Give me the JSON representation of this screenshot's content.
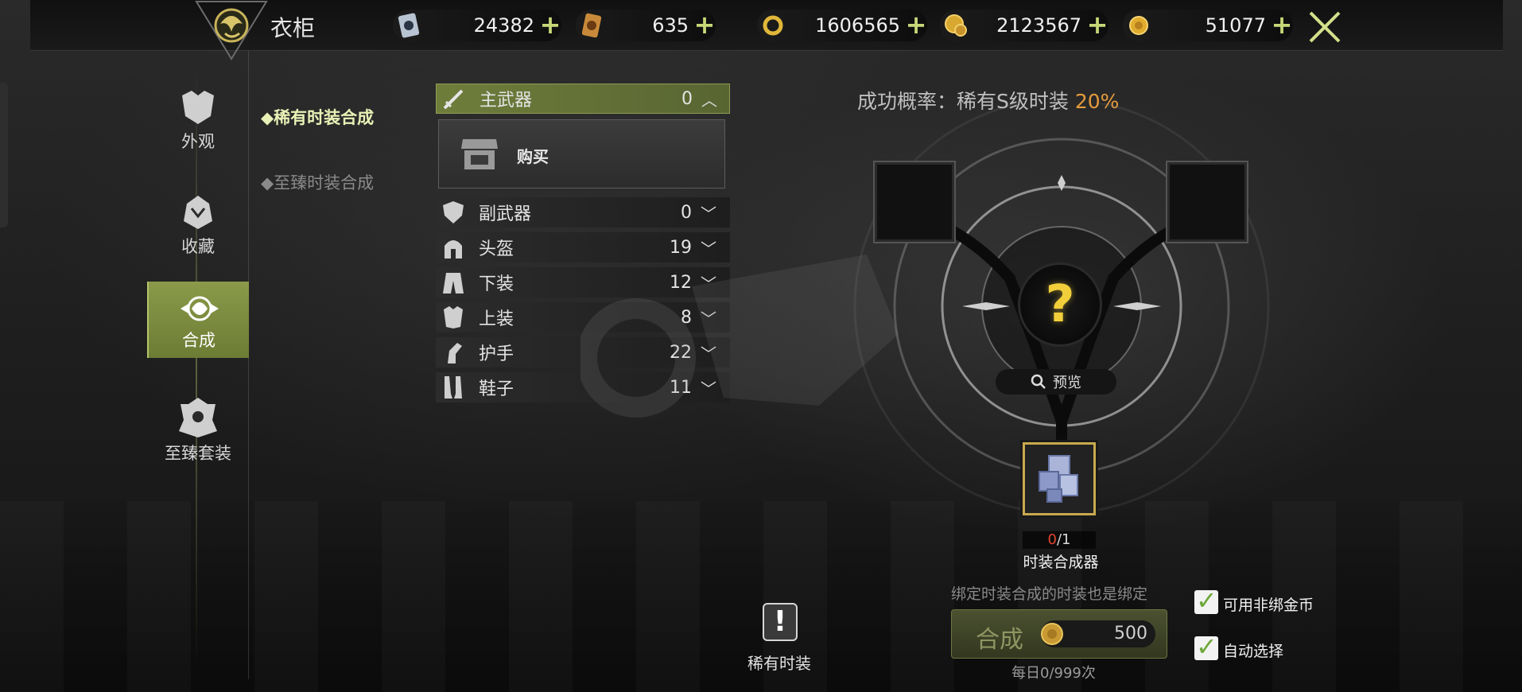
{
  "header": {
    "title": "衣柜",
    "currencies": [
      {
        "icon": "card-ticket-icon",
        "value": "24382"
      },
      {
        "icon": "gold-card-icon",
        "value": "635"
      },
      {
        "icon": "gold-ring-coin-icon",
        "value": "1606565"
      },
      {
        "icon": "gold-coin-stack-icon",
        "value": "2123567"
      },
      {
        "icon": "gold-coin-icon",
        "value": "51077"
      }
    ],
    "plus_symbol": "+"
  },
  "sidebar": {
    "items": [
      {
        "label": "外观",
        "icon": "armor-appearance-icon",
        "active": false
      },
      {
        "label": "收藏",
        "icon": "collection-icon",
        "active": false
      },
      {
        "label": "合成",
        "icon": "synthesis-icon",
        "active": true
      },
      {
        "label": "至臻套装",
        "icon": "supreme-set-icon",
        "active": false
      }
    ]
  },
  "submenu": {
    "items": [
      {
        "label": "稀有时装合成",
        "active": true
      },
      {
        "label": "至臻时装合成",
        "active": false
      }
    ]
  },
  "categories": [
    {
      "name": "主武器",
      "count": "0",
      "icon": "sword-icon",
      "expanded": true
    },
    {
      "name": "副武器",
      "count": "0",
      "icon": "shield-icon",
      "expanded": false
    },
    {
      "name": "头盔",
      "count": "19",
      "icon": "helmet-icon",
      "expanded": false
    },
    {
      "name": "下装",
      "count": "12",
      "icon": "pants-icon",
      "expanded": false
    },
    {
      "name": "上装",
      "count": "8",
      "icon": "chest-armor-icon",
      "expanded": false
    },
    {
      "name": "护手",
      "count": "22",
      "icon": "gauntlet-icon",
      "expanded": false
    },
    {
      "name": "鞋子",
      "count": "11",
      "icon": "boots-icon",
      "expanded": false
    }
  ],
  "buy": {
    "label": "购买",
    "icon": "shop-icon"
  },
  "synthesis": {
    "rate_label": "成功概率：稀有S级时装",
    "rate_value": "20%",
    "result_symbol": "?",
    "preview_label": "预览",
    "material": {
      "have": "0",
      "need": "/1",
      "name": "时装合成器"
    },
    "bind_note": "绑定时装合成的时装也是绑定",
    "combine_label": "合成",
    "combine_cost": "500",
    "daily_limit": "每日0/999次"
  },
  "options": [
    {
      "label": "可用非绑金币",
      "checked": true
    },
    {
      "label": "自动选择",
      "checked": true
    }
  ],
  "rare_alert": {
    "symbol": "!",
    "label": "稀有时装"
  },
  "colors": {
    "accent": "#8a9a4a",
    "rate": "#e59a3c",
    "gold": "#d8a93a"
  }
}
